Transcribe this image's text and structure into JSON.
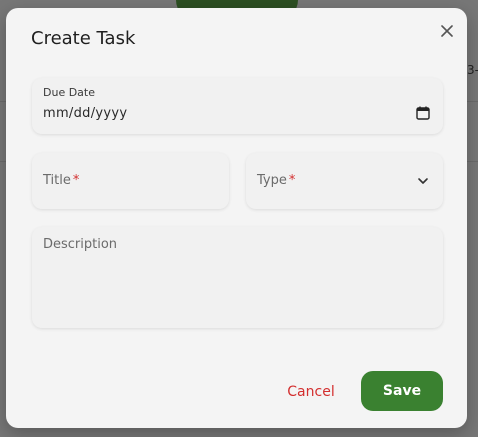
{
  "background": {
    "peek_text": "3-"
  },
  "dialog": {
    "title": "Create Task",
    "close_icon": "close-icon"
  },
  "form": {
    "due_date": {
      "label": "Due Date",
      "value": "mm/dd/yyyy",
      "icon": "calendar-icon"
    },
    "title": {
      "placeholder": "Title",
      "required_mark": "*"
    },
    "type": {
      "placeholder": "Type",
      "required_mark": "*",
      "icon": "chevron-down-icon"
    },
    "description": {
      "placeholder": "Description"
    }
  },
  "actions": {
    "cancel_label": "Cancel",
    "save_label": "Save"
  },
  "colors": {
    "accent": "#3a8130",
    "danger": "#d32f2f",
    "dialog_bg": "#f4f4f4",
    "backdrop": "#777777"
  }
}
